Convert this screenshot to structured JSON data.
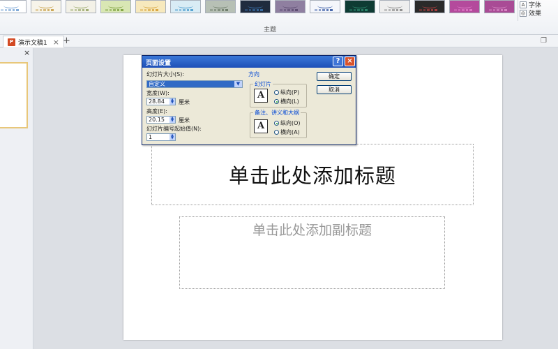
{
  "ribbon": {
    "group_label": "主题",
    "themes": [
      {
        "bg": "#ffffff",
        "accent": "#7aa6d6"
      },
      {
        "bg": "#f7f4ea",
        "accent": "#c9a24c"
      },
      {
        "bg": "#f3f1e7",
        "accent": "#9aa86a"
      },
      {
        "bg": "#d9e7b4",
        "accent": "#7da13d"
      },
      {
        "bg": "#f7e9bd",
        "accent": "#d7a33a"
      },
      {
        "bg": "#d9ecf5",
        "accent": "#4f9fcf"
      },
      {
        "bg": "#b7c0b5",
        "accent": "#6b7a67"
      },
      {
        "bg": "#1f2b3e",
        "accent": "#3a6fa8"
      },
      {
        "bg": "#8f7fa0",
        "accent": "#5b4a70"
      },
      {
        "bg": "#f4f6fb",
        "accent": "#3b5ea6"
      },
      {
        "bg": "#0e3b33",
        "accent": "#2e8a6f"
      },
      {
        "bg": "#eeeeee",
        "accent": "#8a8a8a"
      },
      {
        "bg": "#2a2a2a",
        "accent": "#b04040"
      },
      {
        "bg": "#b44a9c",
        "accent": "#e07ac8"
      },
      {
        "bg": "#a94b95",
        "accent": "#d98ac6"
      }
    ],
    "side_items": [
      {
        "label": "字体",
        "icon": "font-icon"
      },
      {
        "label": "效果",
        "icon": "effects-icon"
      }
    ]
  },
  "tabbar": {
    "doc_tab": "演示文稿1",
    "doc_icon": "P",
    "close": "×",
    "new_tab": "+"
  },
  "left_panel": {
    "close": "×"
  },
  "slide": {
    "title_placeholder": "单击此处添加标题",
    "subtitle_placeholder": "单击此处添加副标题"
  },
  "dialog": {
    "title": "页面设置",
    "help": "?",
    "close": "×",
    "size_label": "幻灯片大小(S):",
    "size_value": "自定义",
    "width_label": "宽度(W):",
    "width_value": "28.84",
    "width_unit": "厘米",
    "height_label": "高度(E):",
    "height_value": "20.15",
    "height_unit": "厘米",
    "start_label": "幻灯片编号起始值(N):",
    "start_value": "1",
    "orientation_label": "方向",
    "slides_group": "幻灯片",
    "slides_portrait": "纵向(P)",
    "slides_landscape": "横向(L)",
    "notes_group": "备注、讲义和大纲",
    "notes_portrait": "纵向(O)",
    "notes_landscape": "横向(A)",
    "orient_glyph": "A",
    "ok": "确定",
    "cancel": "取消"
  }
}
